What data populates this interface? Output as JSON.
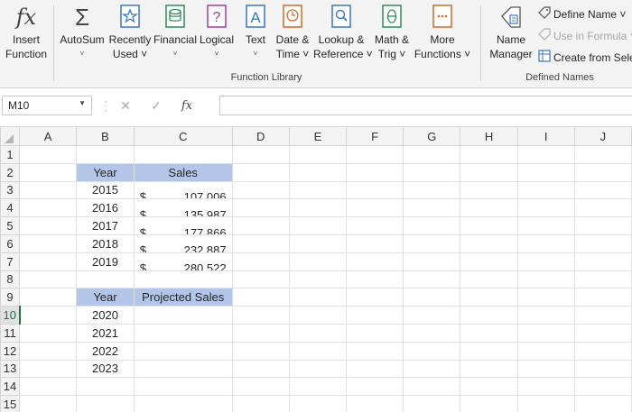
{
  "ribbon": {
    "buttons": [
      {
        "label1": "Insert",
        "label2": "Function",
        "icon": "function-icon"
      },
      {
        "label1": "AutoSum",
        "label2": "˅",
        "icon": "sigma-icon"
      },
      {
        "label1": "Recently",
        "label2": "Used ˅",
        "icon": "star-icon"
      },
      {
        "label1": "Financial",
        "label2": "˅",
        "icon": "coins-icon"
      },
      {
        "label1": "Logical",
        "label2": "˅",
        "icon": "question-icon"
      },
      {
        "label1": "Text",
        "label2": "˅",
        "icon": "text-a-icon"
      },
      {
        "label1": "Date &",
        "label2": "Time ˅",
        "icon": "clock-icon"
      },
      {
        "label1": "Lookup &",
        "label2": "Reference ˅",
        "icon": "magnifier-icon"
      },
      {
        "label1": "Math &",
        "label2": "Trig ˅",
        "icon": "theta-icon"
      },
      {
        "label1": "More",
        "label2": "Functions ˅",
        "icon": "more-functions-icon"
      }
    ],
    "function_library_label": "Function Library",
    "name_manager": {
      "label1": "Name",
      "label2": "Manager"
    },
    "define_name": "Define Name ˅",
    "use_in_formula": "Use in Formula ˅",
    "create_from_selection": "Create from Sele",
    "defined_names_label": "Defined Names"
  },
  "formula_bar": {
    "name_box": "M10",
    "fx_label": "fx",
    "formula": ""
  },
  "sheet": {
    "columns": [
      "A",
      "B",
      "C",
      "D",
      "E",
      "F",
      "G",
      "H",
      "I",
      "J"
    ],
    "rows": [
      "1",
      "2",
      "3",
      "4",
      "5",
      "6",
      "7",
      "8",
      "9",
      "10",
      "11",
      "12",
      "13",
      "14",
      "15"
    ],
    "active_row": "10",
    "table1": {
      "headers": [
        "Year",
        "Sales"
      ],
      "rows": [
        {
          "year": "2015",
          "currency": "$",
          "amount": "107,006"
        },
        {
          "year": "2016",
          "currency": "$",
          "amount": "135,987"
        },
        {
          "year": "2017",
          "currency": "$",
          "amount": "177,866"
        },
        {
          "year": "2018",
          "currency": "$",
          "amount": "232,887"
        },
        {
          "year": "2019",
          "currency": "$",
          "amount": "280,522"
        }
      ]
    },
    "table2": {
      "headers": [
        "Year",
        "Projected Sales"
      ],
      "rows": [
        {
          "year": "2020"
        },
        {
          "year": "2021"
        },
        {
          "year": "2022"
        },
        {
          "year": "2023"
        }
      ]
    },
    "colors": {
      "header_fill": "#b4c6e7",
      "accent": "#217346"
    }
  }
}
